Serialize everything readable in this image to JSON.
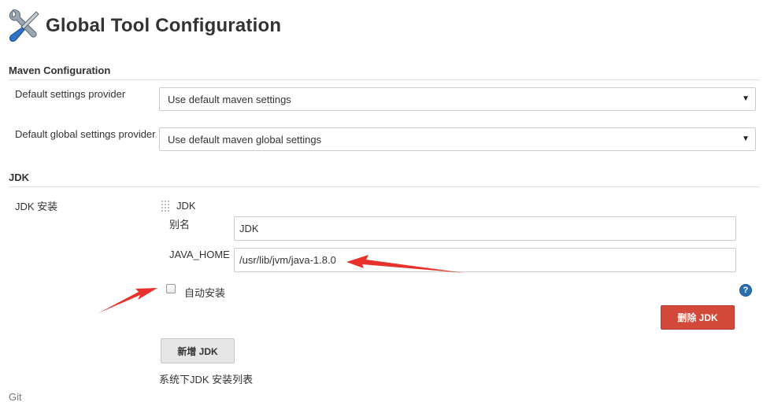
{
  "page": {
    "title": "Global Tool Configuration"
  },
  "maven": {
    "section_title": "Maven Configuration",
    "settings_label": "Default settings provider",
    "settings_value": "Use default maven settings",
    "global_settings_label": "Default global settings provider",
    "global_settings_value": "Use default maven global settings"
  },
  "jdk": {
    "section_title": "JDK",
    "installations_label": "JDK 安装",
    "item_header": "JDK",
    "alias_label": "别名",
    "alias_value": "JDK",
    "java_home_label": "JAVA_HOME",
    "java_home_value": "/usr/lib/jvm/java-1.8.0",
    "auto_install_label": "自动安装",
    "auto_install_checked": false,
    "delete_button": "删除 JDK",
    "add_button": "新增 JDK",
    "list_caption": "系统下JDK 安装列表"
  },
  "git": {
    "section_title": "Git"
  },
  "icons": {
    "header": "tools-icon",
    "help": "help-icon",
    "help_glyph": "?",
    "dropdown": "chevron-down-icon",
    "dropdown_glyph": "▼"
  },
  "colors": {
    "danger": "#d24939",
    "annotation": "#e8312a",
    "help": "#2a6fb2"
  }
}
